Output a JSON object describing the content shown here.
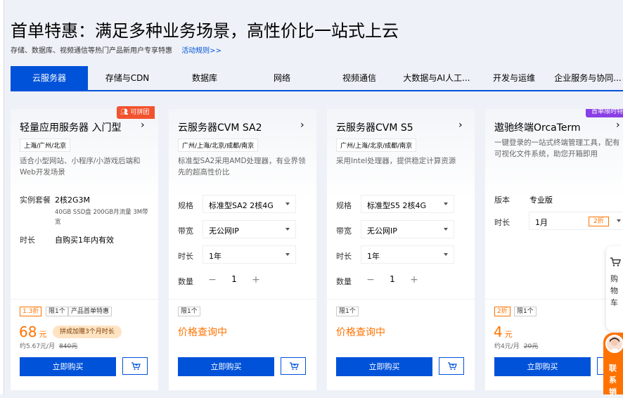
{
  "header": {
    "title": "首单特惠：满足多种业务场景，高性价比一站式上云",
    "subtitle": "存储、数据库、视频通信等热门产品新用户专享特惠",
    "rules_link": "活动规则>>"
  },
  "tabs": [
    "云服务器",
    "存储与CDN",
    "数据库",
    "网络",
    "视频通信",
    "大数据与AI人工...",
    "开发与运维",
    "企业服务与协同..."
  ],
  "active_tab": "云服务器",
  "cards": [
    {
      "name": "轻量应用服务器 入门型",
      "badge": "可拼团",
      "region": "上海/广州/北京",
      "desc": "适合小型网站、小程序/小游戏后端和Web开发场景",
      "spec_label": "实例套餐",
      "spec_value": "2核2G3M",
      "spec_detail": "40GB SSD盘 200GB月流量 3M带宽",
      "time_label": "时长",
      "time_value": "自购买1年内有效",
      "tags": [
        "1.3折",
        "限1个",
        "产品首单特惠"
      ],
      "price": "68",
      "price_unit": "元",
      "promo": "拼成加赠3个月时长",
      "price_note": "约5.67元/月",
      "orig_price": "840元",
      "buy": "立即购买"
    },
    {
      "name": "云服务器CVM SA2",
      "region": "广州/上海/北京/成都/南京",
      "desc": "标准型SA2采用AMD处理器，有业界领先的超高性价比",
      "spec_label": "规格",
      "spec_value": "标准型SA2 2核4G",
      "bw_label": "带宽",
      "bw_value": "无公网IP",
      "time_label": "时长",
      "time_value": "1年",
      "qty_label": "数量",
      "qty": "1",
      "tags": [
        "限1个"
      ],
      "price_query": "价格查询中",
      "buy": "立即购买"
    },
    {
      "name": "云服务器CVM S5",
      "region": "广州/上海/北京/成都/南京",
      "desc": "采用Intel处理器，提供稳定计算资源",
      "spec_label": "规格",
      "spec_value": "标准型S5 2核4G",
      "bw_label": "带宽",
      "bw_value": "无公网IP",
      "time_label": "时长",
      "time_value": "1年",
      "qty_label": "数量",
      "qty": "1",
      "tags": [
        "限1个"
      ],
      "price_query": "价格查询中",
      "buy": "立即购买"
    },
    {
      "name": "遨驰终端OrcaTerm",
      "badge": "首单限时特",
      "desc": "一键登录的一站式终端管理工具，配有可视化文件系统，助您开箱即用",
      "version_label": "版本",
      "version_value": "专业版",
      "time_label": "时长",
      "time_value": "1月",
      "time_discount": "2折",
      "tags": [
        "2折",
        "限1个"
      ],
      "price": "4",
      "price_unit": "元",
      "price_note": "约4元/月",
      "orig_price": "20元",
      "buy": "立即购买"
    }
  ],
  "float_cart": "购物车",
  "float_contact": "联系销",
  "colors": {
    "primary": "#0052d9",
    "orange": "#ff7200",
    "badge_red": "#f2532f",
    "badge_purple": "#8a3ee6"
  }
}
